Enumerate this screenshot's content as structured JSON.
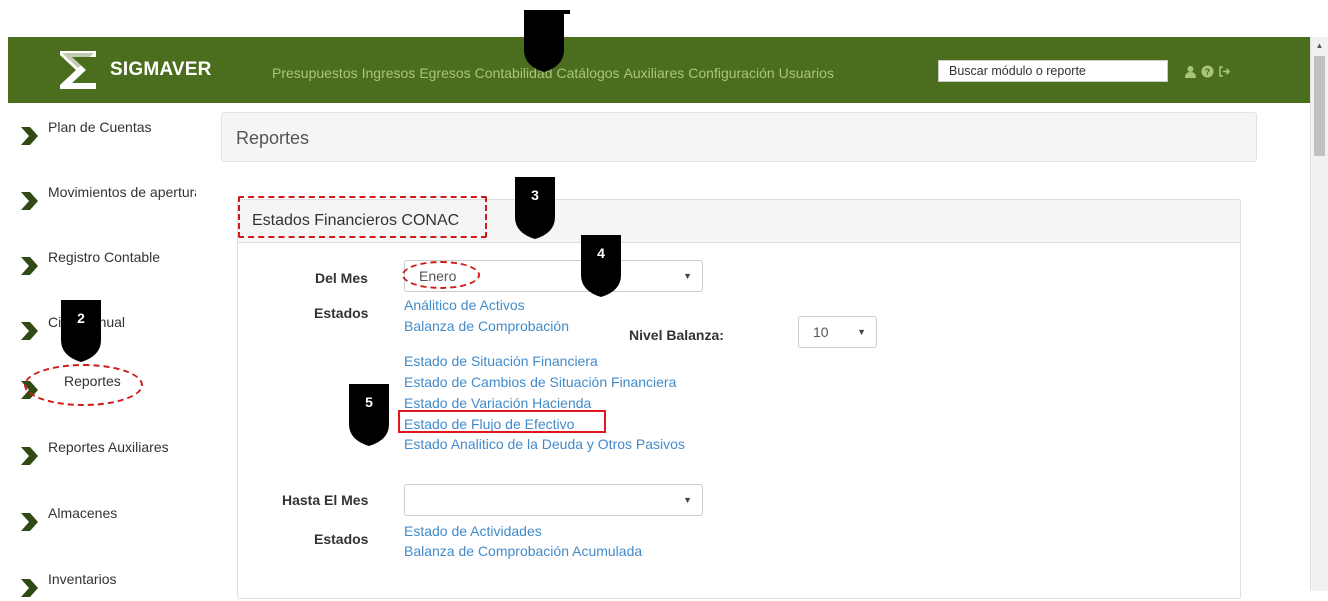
{
  "app": {
    "brand": "SIGMAVER",
    "nav": [
      "Presupuestos",
      "Ingresos",
      "Egresos",
      "Contabilidad",
      "Catálogos",
      "Auxiliares",
      "Configuración",
      "Usuarios"
    ],
    "search_placeholder": "Buscar módulo o reporte",
    "icons": [
      "user-icon",
      "help-icon",
      "logout-icon"
    ]
  },
  "sidebar": {
    "items": [
      {
        "label": "Plan de Cuentas"
      },
      {
        "label": "Movimientos de apertura"
      },
      {
        "label": "Registro Contable"
      },
      {
        "label": "Cierre Anual"
      },
      {
        "label": "Reportes"
      },
      {
        "label": "Reportes Auxiliares"
      },
      {
        "label": "Almacenes"
      },
      {
        "label": "Inventarios"
      }
    ]
  },
  "page": {
    "title": "Reportes",
    "panel_title": "Estados Financieros CONAC",
    "del_mes_label": "Del Mes",
    "del_mes_value": "Enero",
    "estados_label": "Estados",
    "nivel_label": "Nivel Balanza:",
    "nivel_value": "10",
    "estados_links_1": [
      "Análitico de Activos",
      "Balanza de Comprobación"
    ],
    "estados_links_2": [
      "Estado de Situación Financiera",
      "Estado de Cambios de Situación Financiera",
      "Estado de Variación Hacienda",
      "Estado de Flujo de Efectivo",
      "Estado Analitico de la Deuda y Otros Pasivos"
    ],
    "hasta_label": "Hasta El Mes",
    "hasta_value": "",
    "estados2_label": "Estados",
    "estados_links_3": [
      "Estado de Actividades",
      "Balanza de Comprobación Acumulada"
    ]
  },
  "annotations": {
    "markers": [
      "2",
      "3",
      "4",
      "5"
    ],
    "highlight_color": "#d11a1a"
  }
}
